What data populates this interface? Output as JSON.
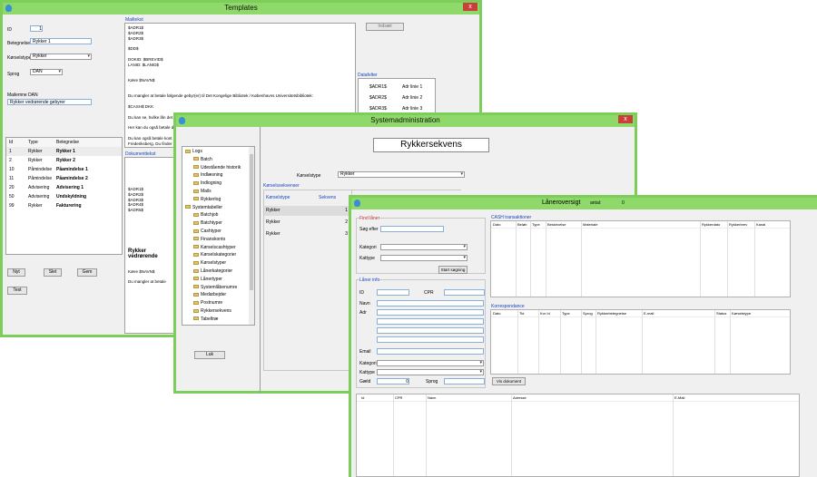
{
  "templates": {
    "title": "Templates",
    "close": "x",
    "id_label": "ID",
    "id_value": "1",
    "betegnelse_label": "Betegnelse",
    "betegnelse_value": "Rykker 1",
    "korselstype_label": "Kørselstype",
    "korselstype_value": "Rykker",
    "sprog_label": "Sprog",
    "sprog_value": "DAN",
    "mailemne_label": "Mailemne DAN",
    "mailemne_value": "Rykker vedrørende gebyrer",
    "mailtekst_label": "Mailtekst",
    "mailtekst_lines": [
      "$ADR1$",
      "$ADR2$",
      "$ADR3$",
      "",
      "$DD$",
      "",
      "DOKID: $BREVID$",
      "LANID: $LANID$",
      "",
      "",
      "Kære $NAVN$",
      "",
      "",
      "Du mangler at betale følgende gebyr(er) til Det Kongelige Bibliotek / Københavns Universitetsbibliotek:",
      "",
      "$CASH$ DKK",
      "",
      "Du kan se, hvilke lån det vedrører ved at logge på REX ($LINK$); klikke på dit navn og derefter på \"Gebyrer\".",
      "",
      "Her kan du også betale d",
      "",
      "Du kan også betale kont",
      "Frederiksberg. Du finder a"
    ],
    "indsaet_button": "Indsæt",
    "datafelter_label": "Datafelter",
    "datafelter": [
      [
        "$ADR1$",
        "Adr linie 1"
      ],
      [
        "$ADR2$",
        "Adr linie 2"
      ],
      [
        "$ADR3$",
        "Adr linie 3"
      ]
    ],
    "list_headers": [
      "Id",
      "Type",
      "Betegnelse"
    ],
    "list_rows": [
      [
        "1",
        "Rykker",
        "Rykker 1"
      ],
      [
        "2",
        "Rykker",
        "Rykker 2"
      ],
      [
        "10",
        "Påmindelse",
        "Påamindelse 1"
      ],
      [
        "11",
        "Påmindelse",
        "Påamindelse 2"
      ],
      [
        "20",
        "Advisering",
        "Advisering 1"
      ],
      [
        "50",
        "Advisering",
        "Undskyldning"
      ],
      [
        "99",
        "Rykker",
        "Fakturering"
      ]
    ],
    "nyt_button": "Nyt",
    "slet_button": "Slet",
    "gem_button": "Gem",
    "test_button": "Test",
    "dokumenttekst_label": "Dokumenttekst",
    "dok_lines": [
      "$ADR1$",
      "$ADR2$",
      "$ADR3$",
      "$ADR4$",
      "$ADR5$"
    ],
    "dok_heading": "Rykker vedrørende",
    "dok_lines2": [
      "Kære $NAVN$",
      "",
      "Du mangler at betale"
    ]
  },
  "sysadm": {
    "title": "Systemadministration",
    "close": "x",
    "tree": [
      {
        "label": "Logs",
        "level": 0
      },
      {
        "label": "Batch",
        "level": 1
      },
      {
        "label": "Udestående historik",
        "level": 1
      },
      {
        "label": "Indlæsning",
        "level": 1
      },
      {
        "label": "Indlogning",
        "level": 1
      },
      {
        "label": "Mails",
        "level": 1
      },
      {
        "label": "Rykkerlog",
        "level": 1
      },
      {
        "label": "Systemtabeller",
        "level": 0
      },
      {
        "label": "Batchjob",
        "level": 1
      },
      {
        "label": "Batchtyper",
        "level": 1
      },
      {
        "label": "Cashtyper",
        "level": 1
      },
      {
        "label": "Finanskonto",
        "level": 1
      },
      {
        "label": "Kørselscashtyper",
        "level": 1
      },
      {
        "label": "Kørselskategorier",
        "level": 1
      },
      {
        "label": "Kørselstyper",
        "level": 1
      },
      {
        "label": "Lånerkategorier",
        "level": 1
      },
      {
        "label": "Lånertyper",
        "level": 1
      },
      {
        "label": "Systemlåbenumre",
        "level": 1
      },
      {
        "label": "Medarbejder",
        "level": 1
      },
      {
        "label": "Postnumre",
        "level": 1
      },
      {
        "label": "Rykkersekvens",
        "level": 1
      },
      {
        "label": "Tabeltræ",
        "level": 1
      }
    ],
    "luk_button": "Luk",
    "heading": "Rykkersekvens",
    "korselstype_label": "Kørselstype",
    "korselstype_value": "Rykker",
    "group_label": "Kørselssekvenser",
    "col1": "Kørselstype",
    "col2": "Sekvens",
    "rows": [
      [
        "Rykker",
        "1"
      ],
      [
        "Rykker",
        "2"
      ],
      [
        "Rykker",
        "3"
      ]
    ]
  },
  "laaner": {
    "title": "Låneroversigt",
    "antal_label": "antal:",
    "antal_value": "0",
    "find_laaner": "Find låner",
    "soeg_efter": "Søg efter",
    "kategori": "Kategori",
    "kattype": "Kattype",
    "start_soegning": "Start søgning",
    "laaner_info": "Låner info",
    "id": "ID",
    "cpr": "CPR",
    "navn": "Navn",
    "adr": "Adr",
    "email": "Email",
    "kategori2": "Kategori",
    "kattype2": "Kattype",
    "gaeld": "Gæld",
    "gaeld_value": "0",
    "sprog": "Sprog",
    "cash_label": "CASH transaktioner",
    "cash_cols": [
      "Dato",
      "Beløb",
      "Type",
      "Beskrivelse",
      "Materiale",
      "Rykkerdato",
      "Rykkerbrev",
      "Kanal"
    ],
    "korr_label": "Korrespondance",
    "korr_cols": [
      "Dato",
      "Tid",
      "Kor Id",
      "Type",
      "Sprog",
      "Rykkerbetegnelse",
      "E-mail",
      "Status",
      "Kørselstype"
    ],
    "vis_dokument": "Vis dokument",
    "bottom_cols": [
      "Id",
      "CPR",
      "Navn",
      "Adresse",
      "E-Mail"
    ]
  }
}
